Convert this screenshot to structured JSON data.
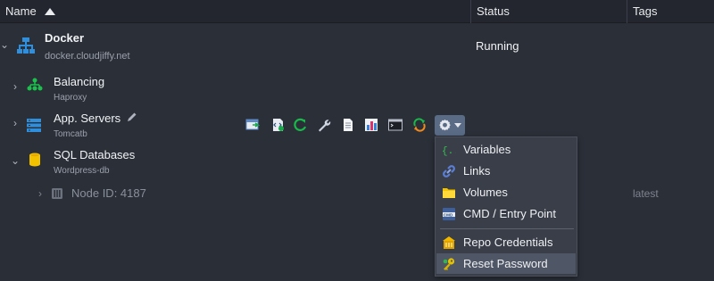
{
  "header": {
    "name_label": "Name",
    "status_label": "Status",
    "tags_label": "Tags"
  },
  "environment": {
    "name": "Docker",
    "domain": "docker.cloudjiffy.net",
    "status": "Running"
  },
  "nodes": [
    {
      "name": "Balancing",
      "sub": "Haproxy"
    },
    {
      "name": "App. Servers",
      "sub": "Tomcatb"
    },
    {
      "name": "SQL Databases",
      "sub": "Wordpress-db"
    }
  ],
  "subnode": {
    "label": "Node ID: 4187",
    "tag": "latest"
  },
  "toolbar": {
    "icons": [
      "open-in-browser-icon",
      "config-icon",
      "restart-icon",
      "settings-icon",
      "log-icon",
      "statistics-icon",
      "web-ssh-icon",
      "redeploy-icon",
      "gear-icon"
    ]
  },
  "menu": {
    "items": [
      {
        "label": "Variables",
        "icon": "variables-icon"
      },
      {
        "label": "Links",
        "icon": "link-icon"
      },
      {
        "label": "Volumes",
        "icon": "folder-icon"
      },
      {
        "label": "CMD / Entry Point",
        "icon": "cmd-icon"
      },
      {
        "label": "Repo Credentials",
        "icon": "repo-credentials-icon"
      },
      {
        "label": "Reset Password",
        "icon": "reset-password-icon"
      }
    ],
    "active_index": 5
  },
  "colors": {
    "background": "#2a2e37",
    "header": "#23262e",
    "menu": "#3a3e48",
    "menu_active": "#4f5665",
    "accent_blue": "#2f8fdd",
    "accent_green": "#19c24a",
    "accent_yellow": "#f2c200"
  }
}
